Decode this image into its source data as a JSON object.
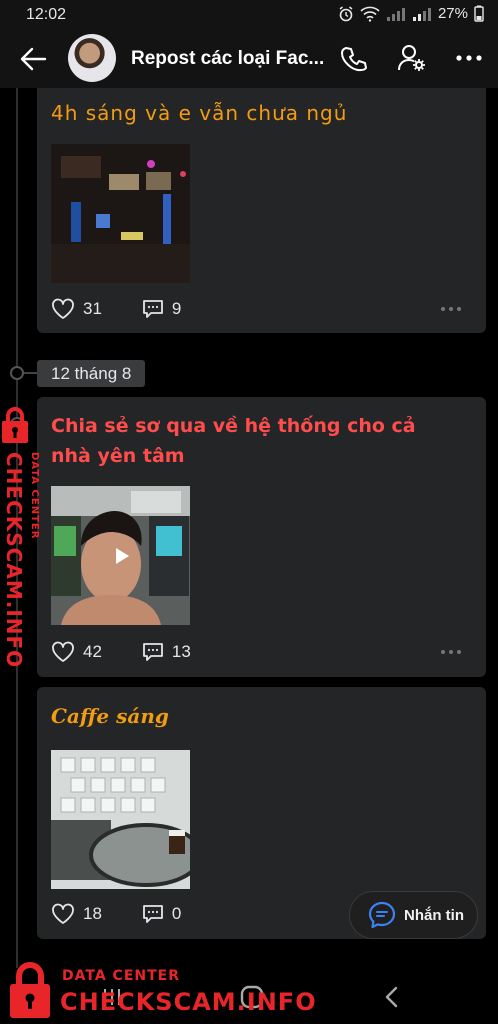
{
  "status_bar": {
    "time": "12:02",
    "battery": "27%"
  },
  "header": {
    "title": "Repost các loại Fac..."
  },
  "posts": [
    {
      "title": "4h sáng và e vẫn chưa ngủ",
      "likes": "31",
      "comments": "9"
    },
    {
      "title": "Chia sẻ sơ qua về hệ thống cho cả nhà yên tâm",
      "likes": "42",
      "comments": "13"
    },
    {
      "title": "Caffe sáng",
      "likes": "18",
      "comments": "0"
    }
  ],
  "date_chip": "12 tháng 8",
  "message_button": {
    "label": "Nhắn tin"
  },
  "watermark": {
    "sub": "DATA CENTER",
    "main": "CHECKSCAM.INFO"
  },
  "colors": {
    "card_bg": "#242526",
    "orange_title": "#f39c12",
    "red_title": "#ff4d4d",
    "watermark_red": "#e8262a"
  }
}
